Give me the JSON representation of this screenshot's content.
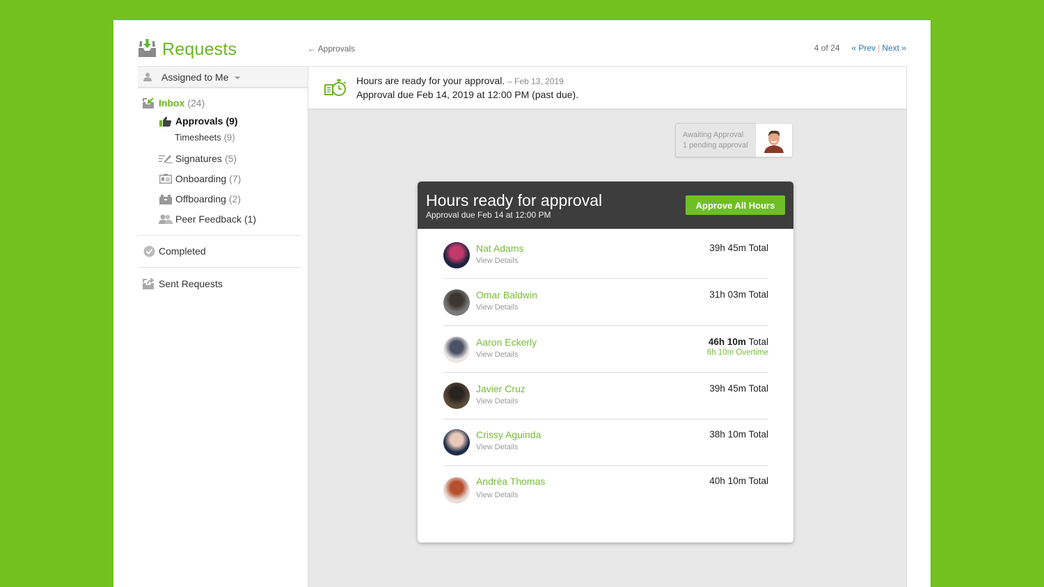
{
  "header": {
    "title": "Requests",
    "back_link": "← Approvals",
    "pager": {
      "position": "4 of 24",
      "prev": "« Prev",
      "separator": "|",
      "next": "Next »"
    }
  },
  "sidebar": {
    "filter": "Assigned to Me",
    "items": [
      {
        "label": "Inbox",
        "count": "(24)",
        "icon": "inbox-icon"
      },
      {
        "label": "Approvals",
        "count": "(9)",
        "icon": "thumbs-up-icon"
      },
      {
        "label": "Timesheets",
        "count": "(9)",
        "icon": ""
      },
      {
        "label": "Signatures",
        "count": "(5)",
        "icon": "signature-icon"
      },
      {
        "label": "Onboarding",
        "count": "(7)",
        "icon": "id-card-icon"
      },
      {
        "label": "Offboarding",
        "count": "(2)",
        "icon": "briefcase-icon"
      },
      {
        "label": "Peer Feedback",
        "count": "(1)",
        "icon": "people-icon"
      },
      {
        "label": "Completed",
        "count": "",
        "icon": "check-circle-icon"
      },
      {
        "label": "Sent Requests",
        "count": "",
        "icon": "outbox-icon"
      }
    ]
  },
  "notice": {
    "line1": "Hours are ready for your approval.",
    "date": "– Feb 13, 2019",
    "line2": "Approval due Feb 14, 2019 at 12:00 PM (past due)."
  },
  "awaiting": {
    "status": "Awaiting Approval",
    "pending": "1 pending approval"
  },
  "card": {
    "title": "Hours ready for approval",
    "subtitle": "Approval due Feb 14 at 12:00 PM",
    "approve_button": "Approve All Hours",
    "details_label": "View Details",
    "total_suffix": "Total",
    "employees": [
      {
        "name": "Nat Adams",
        "hours": "39h 45m",
        "overtime": "",
        "bold": false,
        "avatar_colors": [
          "#1c2340",
          "#c23a6a"
        ]
      },
      {
        "name": "Omar Baldwin",
        "hours": "31h 03m",
        "overtime": "",
        "bold": false,
        "avatar_colors": [
          "#7a7a7a",
          "#3c3530"
        ]
      },
      {
        "name": "Aaron Eckerly",
        "hours": "46h 10m",
        "overtime": "6h 10m Overtime",
        "bold": true,
        "avatar_colors": [
          "#ece7e4",
          "#4c5266"
        ]
      },
      {
        "name": "Javier Cruz",
        "hours": "39h 45m",
        "overtime": "",
        "bold": false,
        "avatar_colors": [
          "#5a4a38",
          "#2a2420"
        ]
      },
      {
        "name": "Crissy Aguinda",
        "hours": "38h 10m",
        "overtime": "",
        "bold": false,
        "avatar_colors": [
          "#1e2e4a",
          "#e8c8b8"
        ]
      },
      {
        "name": "Andréa Thomas",
        "hours": "40h 10m",
        "overtime": "",
        "bold": false,
        "avatar_colors": [
          "#e8ddd8",
          "#b5502e"
        ]
      }
    ]
  },
  "colors": {
    "brand_green": "#72c11f",
    "link_green": "#76bb3a",
    "header_dark": "#3d3d3d",
    "link_blue": "#2a78b8"
  }
}
